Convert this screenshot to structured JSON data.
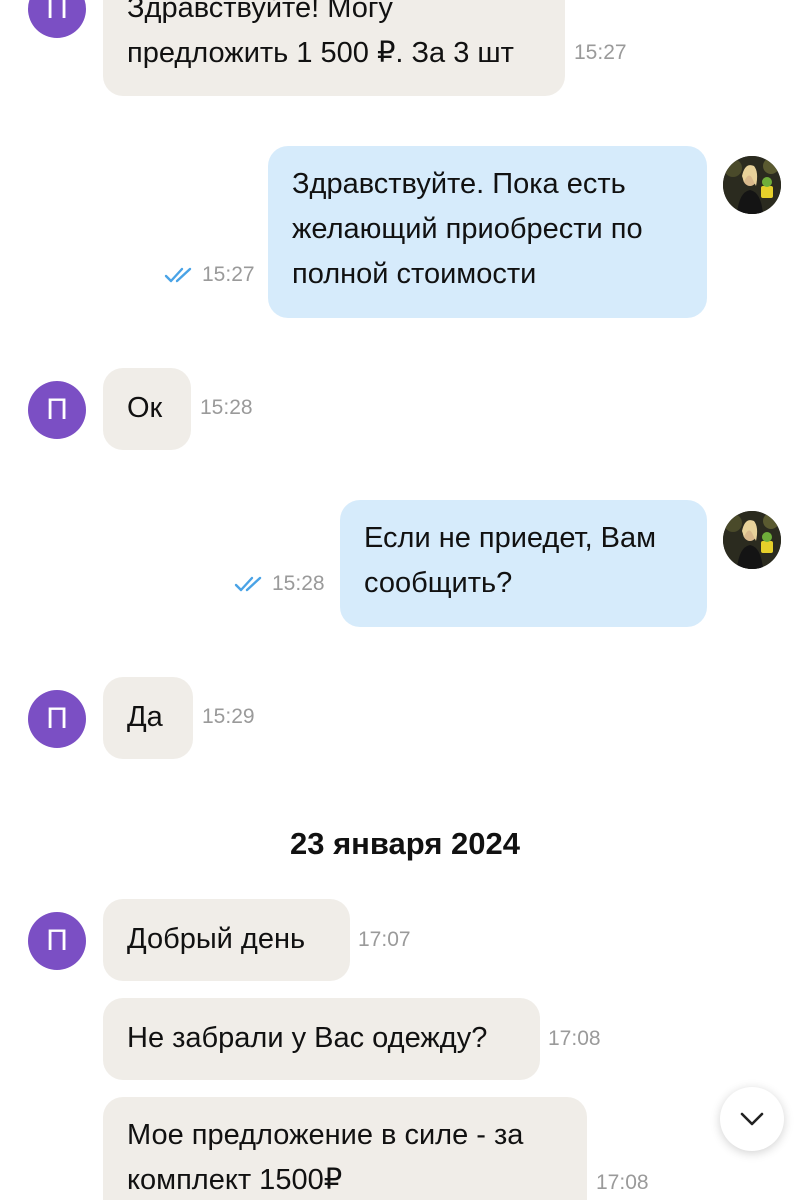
{
  "contact_initial": "П",
  "date_divider": "23 января 2024",
  "colors": {
    "incoming_bubble": "#f0ede8",
    "outgoing_bubble": "#d6ebfb",
    "avatar": "#7b4fc4",
    "read_check": "#4aa3e6"
  },
  "messages": [
    {
      "lines": [
        "Здравствуйте! Могу",
        "предложить 1 500 ₽. За 3 шт"
      ],
      "time": "15:27",
      "direction": "incoming"
    },
    {
      "lines": [
        "Здравствуйте. Пока есть",
        "желающий приобрести по",
        "полной стоимости"
      ],
      "time": "15:27",
      "direction": "outgoing",
      "status": "read"
    },
    {
      "lines": [
        "Ок"
      ],
      "time": "15:28",
      "direction": "incoming"
    },
    {
      "lines": [
        "Если не приедет, Вам",
        "сообщить?"
      ],
      "time": "15:28",
      "direction": "outgoing",
      "status": "read"
    },
    {
      "lines": [
        "Да"
      ],
      "time": "15:29",
      "direction": "incoming"
    },
    {
      "lines": [
        "Добрый день"
      ],
      "time": "17:07",
      "direction": "incoming"
    },
    {
      "lines": [
        "Не забрали у Вас одежду?"
      ],
      "time": "17:08",
      "direction": "incoming"
    },
    {
      "lines": [
        "Мое предложение в силе - за",
        "комплект 1500₽"
      ],
      "time": "17:08",
      "direction": "incoming"
    }
  ],
  "icons": {
    "read": "double-check-icon",
    "scroll": "chevron-down-icon"
  }
}
